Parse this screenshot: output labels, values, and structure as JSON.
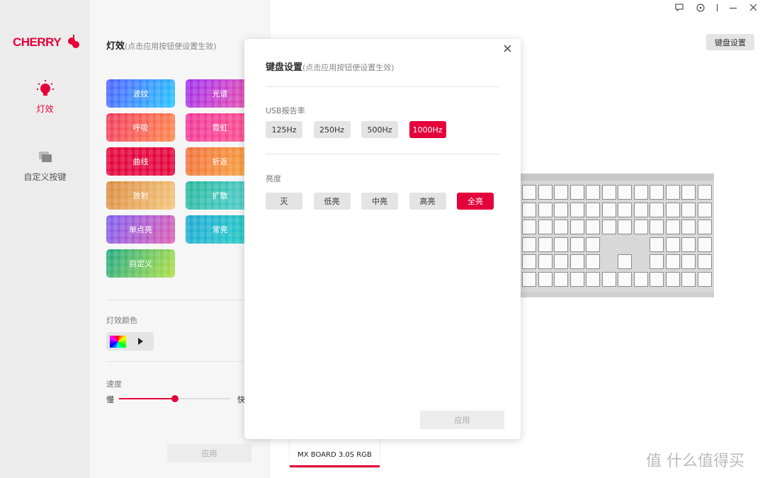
{
  "brand": "CHERRY",
  "sidebar": {
    "items": [
      {
        "label": "灯效",
        "icon": "bulb-icon",
        "active": true
      },
      {
        "label": "自定义按键",
        "icon": "layers-icon",
        "active": false
      }
    ]
  },
  "panel": {
    "title": "灯效",
    "hint": "(点击应用按钮使设置生效)",
    "effects": [
      "波纹",
      "光谱",
      "呼吸",
      "霓虹",
      "曲线",
      "折返",
      "放射",
      "扩散",
      "单点亮",
      "常亮",
      "自定义"
    ],
    "selected_effect": "曲线",
    "color_label": "灯效颜色",
    "speed_label": "速度",
    "speed_slow": "慢",
    "speed_fast": "快",
    "speed_value": 0.5,
    "apply": "应用"
  },
  "titlebar": {
    "icons": [
      "feedback-icon",
      "target-icon",
      "minimize-icon",
      "close-icon"
    ]
  },
  "keyboard_settings_button": "键盘设置",
  "modal": {
    "title": "键盘设置",
    "hint": "(点击应用按钮使设置生效)",
    "usb_label": "USB报告率",
    "usb_options": [
      "125Hz",
      "250Hz",
      "500Hz",
      "1000Hz"
    ],
    "usb_selected": "1000Hz",
    "brightness_label": "亮度",
    "brightness_options": [
      "灭",
      "低亮",
      "中亮",
      "高亮",
      "全亮"
    ],
    "brightness_selected": "全亮",
    "apply": "应用"
  },
  "device": {
    "name": "MX BOARD 3.0S RGB"
  },
  "watermark": "值 什么值得买",
  "colors": {
    "accent": "#e4003a"
  }
}
